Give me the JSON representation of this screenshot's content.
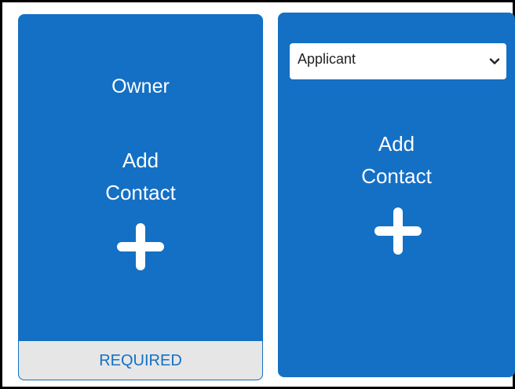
{
  "cards": [
    {
      "role": "Owner",
      "add_label_line1": "Add",
      "add_label_line2": "Contact",
      "footer": "REQUIRED",
      "plus_icon": "plus-icon"
    },
    {
      "role_select": {
        "selected": "Applicant"
      },
      "add_label_line1": "Add",
      "add_label_line2": "Contact",
      "plus_icon": "plus-icon",
      "dropdown_icon": "chevron-down-icon"
    }
  ],
  "colors": {
    "card_blue": "#1470c4",
    "footer_gray": "#e6e6e6",
    "text_white": "#ffffff"
  }
}
